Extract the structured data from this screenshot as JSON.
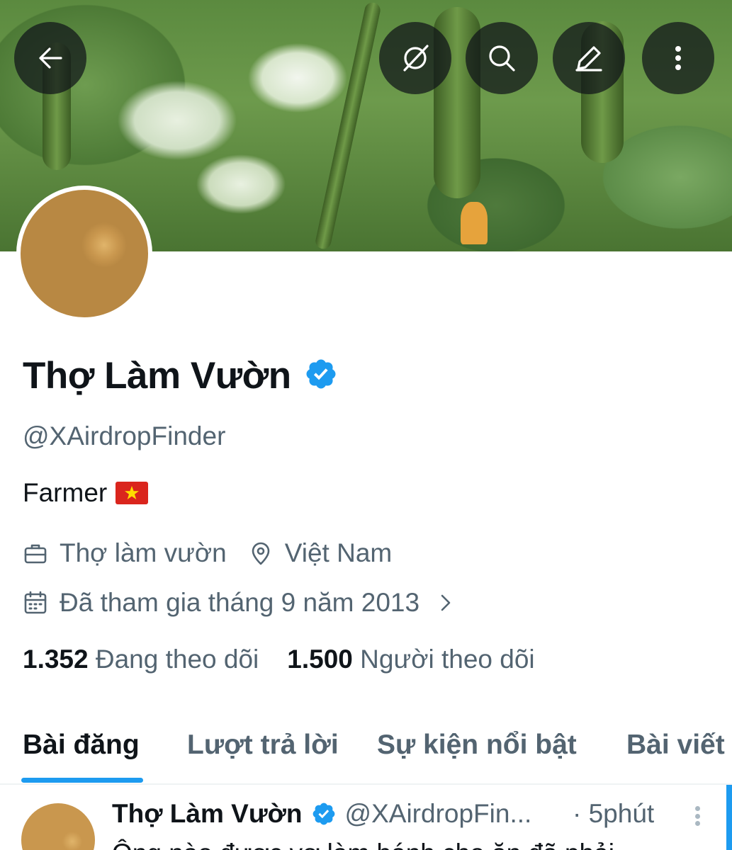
{
  "header": {
    "back_icon": "arrow-left-icon",
    "grok_icon": "grok-icon",
    "search_icon": "search-icon",
    "compose_icon": "pencil-icon",
    "more_icon": "more-vertical-icon"
  },
  "profile": {
    "display_name": "Thợ Làm Vườn",
    "verified": true,
    "handle": "@XAirdropFinder",
    "bio": "Farmer",
    "bio_emoji": "vietnam-flag",
    "profession": "Thợ làm vườn",
    "location": "Việt Nam",
    "joined": "Đã tham gia tháng 9 năm 2013",
    "following_count": "1.352",
    "following_label": "Đang theo dõi",
    "followers_count": "1.500",
    "followers_label": "Người theo dõi"
  },
  "tabs": [
    {
      "label": "Bài đăng",
      "active": true
    },
    {
      "label": "Lượt trả lời",
      "active": false
    },
    {
      "label": "Sự kiện nổi bật",
      "active": false
    },
    {
      "label": "Bài viết",
      "active": false
    }
  ],
  "post": {
    "author": "Thợ Làm Vườn",
    "handle": "@XAirdropFin...",
    "time": "· 5phút",
    "text_partial": "Ông nào được vợ làm bánh cho ăn đã phải"
  },
  "colors": {
    "accent": "#1d9bf0",
    "text": "#0f1419",
    "secondary": "#536471"
  }
}
